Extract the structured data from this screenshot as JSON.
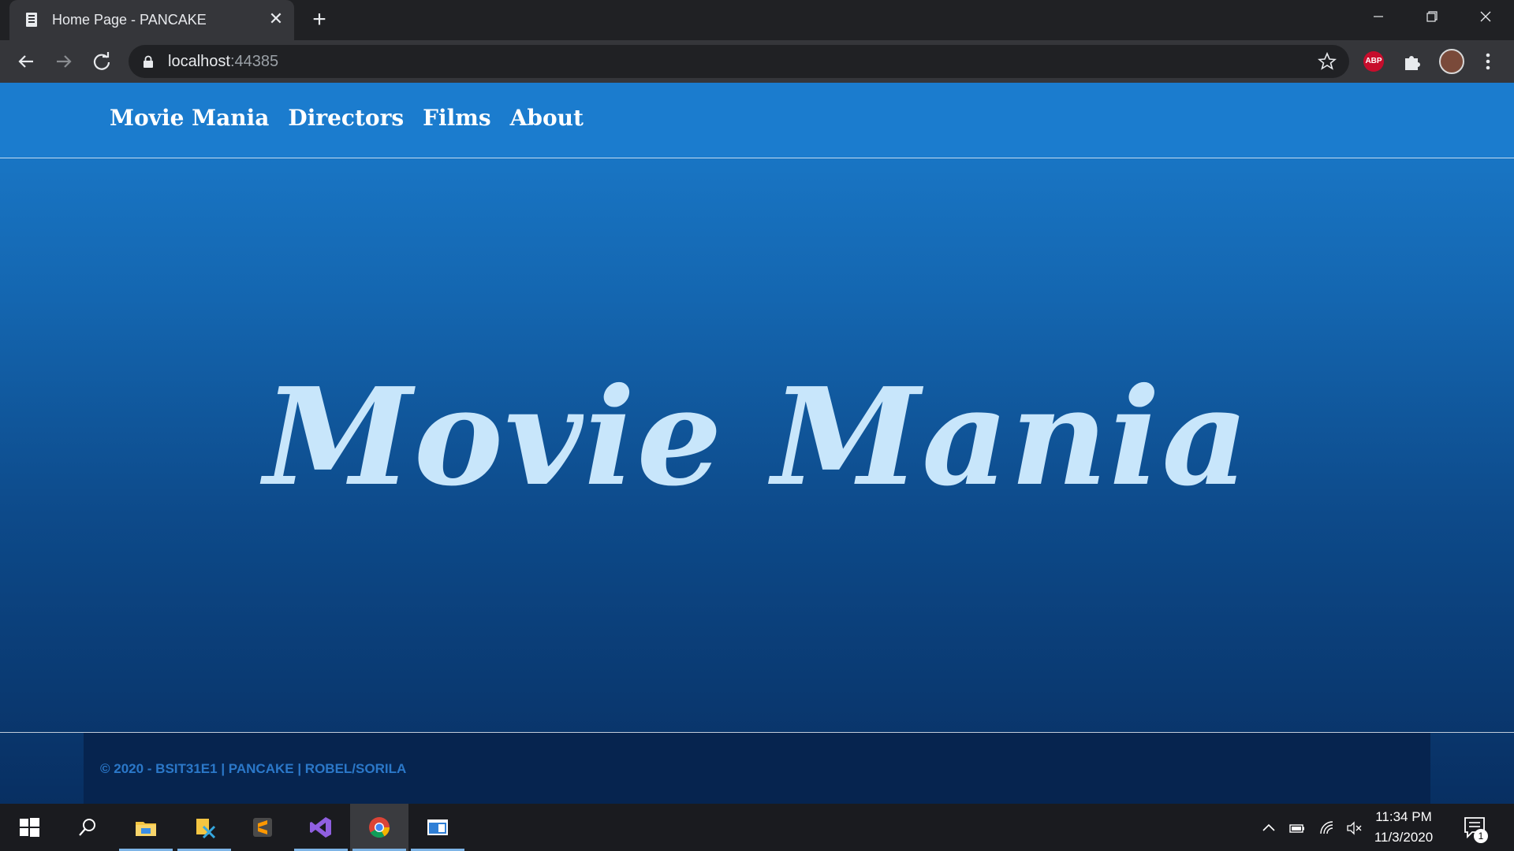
{
  "browser": {
    "tab_title": "Home Page - PANCAKE",
    "tab_close": "✕",
    "new_tab": "+",
    "url_host": "localhost",
    "url_port": ":44385",
    "extension_abp": "ABP",
    "window_min": "—",
    "window_max": "❐",
    "window_close": "✕"
  },
  "site": {
    "nav": [
      "Movie Mania",
      "Directors",
      "Films",
      "About"
    ],
    "hero_title": "Movie Mania",
    "footer_text": "© 2020 - BSIT31E1 | PANCAKE | ROBEL/SORILA",
    "colors": {
      "nav_bg": "#1b7cce",
      "hero_text": "#c8e6fb",
      "footer_bg": "#06244f",
      "footer_text": "#2b78c9"
    }
  },
  "taskbar": {
    "apps": [
      "windows-start-icon",
      "search-icon",
      "file-explorer-icon",
      "database-tool-icon",
      "sublime-text-icon",
      "visual-studio-icon",
      "chrome-icon",
      "window-app-icon"
    ],
    "active_app": "chrome-icon",
    "clock_time": "11:34 PM",
    "clock_date": "11/3/2020",
    "notification_count": "1"
  }
}
